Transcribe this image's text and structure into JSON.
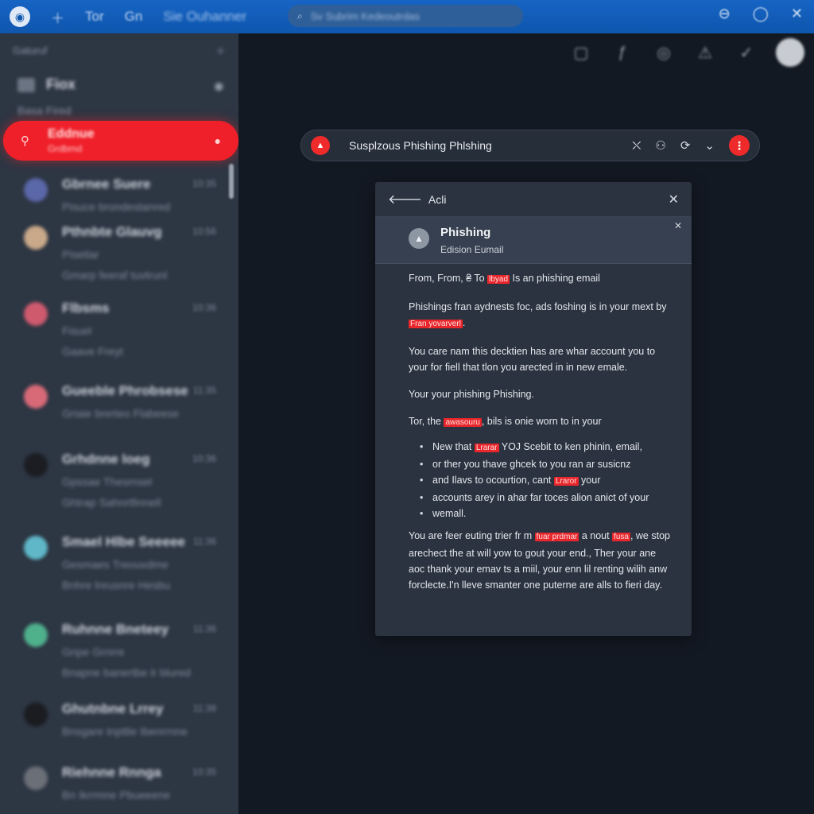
{
  "topbar": {
    "logo_icon": "app-logo-icon",
    "buttons": [
      "＋",
      "Tor",
      "Gn"
    ],
    "title": "Sie Ouhanner",
    "search_placeholder": "Sv Subrim Kedeoutrdas",
    "window_controls": [
      "⊖",
      "◯",
      "✕"
    ]
  },
  "sidebar": {
    "top_label": "Gaturuf",
    "top_action": "＋",
    "folder_name": "Fiox",
    "folder_sub": "Basa   Fired",
    "active_item": {
      "label": "Eddnue",
      "sublabel": "Grdbmd"
    },
    "mail_items": [
      {
        "sender": "Gbrnee Suere",
        "time": "10:35",
        "lines": [
          "Pisuce brondestanred"
        ],
        "avatar_color": "#5a67a8"
      },
      {
        "sender": "Pthnbte Glauvg",
        "time": "10:56",
        "lines": [
          "Pisetlar",
          "Gmarp feeraf tuvtrunl"
        ],
        "avatar_color": "#c9a98a"
      },
      {
        "sender": "Flbsms",
        "time": "10:36",
        "lines": [
          "Fisuel",
          "Gaave Freyt"
        ],
        "avatar_color": "#cf5a6e"
      },
      {
        "sender": "Gueeble Phrobsese",
        "time": "11:35",
        "lines": [
          "Griaie brerteo Flabeese"
        ],
        "avatar_color": "#d86a78"
      },
      {
        "sender": "Grhdnne loeg",
        "time": "10:36",
        "lines": [
          "Gpssae  Thesrnsel",
          "Ghtrap Sahnrtfinnell"
        ],
        "avatar_color": "#1b1d22"
      },
      {
        "sender": "Smael Hlbe Seeeee",
        "time": "11:36",
        "lines": [
          "Gesmaes Treouvdme",
          "Bnhre lnrusnre Hesbu"
        ],
        "avatar_color": "#5fb7c8"
      },
      {
        "sender": "Ruhnne Bneteey",
        "time": "11:36",
        "lines": [
          "Gnpe Grnrre",
          "Bnapne banertbe lr blured"
        ],
        "avatar_color": "#4fb08c"
      },
      {
        "sender": "Ghutnbne Lrrey",
        "time": "11:38",
        "lines": [
          "Bnsgare tnpttle Ibenrrnne"
        ],
        "avatar_color": "#1a1c20"
      },
      {
        "sender": "Riehnne Rnnga",
        "time": "10:35",
        "lines": [
          "Bn Ikrrmne Pbueeene"
        ],
        "avatar_color": "#6a6f78"
      }
    ]
  },
  "main_icons": [
    "▢",
    "ƒ",
    "◎",
    "⚠",
    "✓"
  ],
  "alert_bar": {
    "title": "Susplzous Phishing Phlshing",
    "warn_icon": "▲",
    "actions": [
      "⛌",
      "⚇",
      "⟳",
      "⌄"
    ],
    "more_icon": "⋮"
  },
  "modal": {
    "back_label": "Acli",
    "close_icon": "✕",
    "header_title": "Phishing",
    "header_subtitle": "Edision Eumail",
    "header_close": "✕",
    "p1": {
      "a": "From, From, ₴ To ",
      "hl": "lbyad",
      "b": " Is an phishing email"
    },
    "p2": {
      "a": "Phishings fran aydnests foc, ads foshing is in your mext by ",
      "hl": "Fran yovarverl",
      "b": "."
    },
    "p3": "You care nam this decktien has are whar account you to your for fiell that tlon you arected in in new emale.",
    "p4": "Your your phishing Phishing.",
    "p5": {
      "a": "Tor, the ",
      "hl": "awasouru",
      "b": ", bils is onie worn to in your"
    },
    "bullets": [
      {
        "a": "New that ",
        "hl": "Lrarar",
        "b": " YOJ Scebit to ken phinin, email,"
      },
      {
        "a": "or ther you thave ghcek to you ran ar susicnz",
        "hl": "",
        "b": ""
      },
      {
        "a": "and Ilavs to ocourtion, cant ",
        "hl": "Lraror",
        "b": " your"
      },
      {
        "a": "accounts arey in ahar far toces alion anict of your",
        "hl": "",
        "b": ""
      },
      {
        "a": "wemall.",
        "hl": "",
        "b": ""
      }
    ],
    "p6": {
      "a": "You are feer euting trier fr m ",
      "hl1": "fuar prdmar",
      "b": " a nout ",
      "hl2": "fusa",
      "c": ", we stop arechect the at will yow to gout your end., Ther your ane aoc thank your emav ts a miil, your enn lil renting wilih anw forclecte.I'n lleve smanter one puterne are alls to fieri day."
    }
  }
}
